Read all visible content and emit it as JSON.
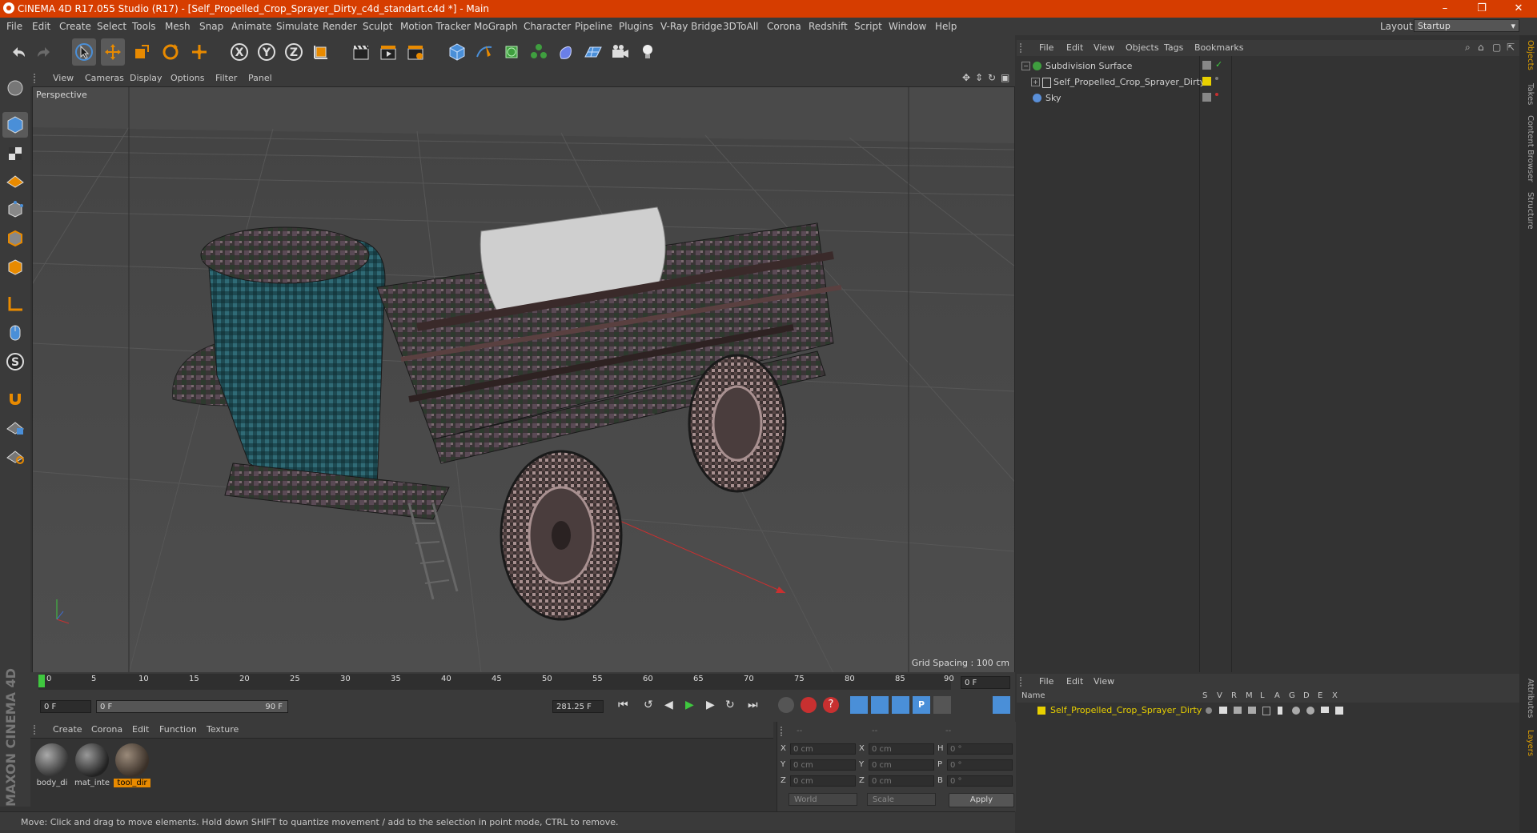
{
  "titlebar": {
    "title": "CINEMA 4D R17.055 Studio (R17) - [Self_Propelled_Crop_Sprayer_Dirty_c4d_standart.c4d *] - Main",
    "minimize": "–",
    "maximize": "❐",
    "close": "✕"
  },
  "menubar": {
    "items": [
      "File",
      "Edit",
      "Create",
      "Select",
      "Tools",
      "Mesh",
      "Snap",
      "Animate",
      "Simulate",
      "Render",
      "Sculpt",
      "Motion Tracker",
      "MoGraph",
      "Character",
      "Pipeline",
      "Plugins",
      "V-Ray Bridge",
      "3DToAll",
      "Corona",
      "Redshift",
      "Script",
      "Window",
      "Help"
    ],
    "layout_label": "Layout:",
    "layout_value": "Startup"
  },
  "viewport": {
    "menu": [
      "View",
      "Cameras",
      "Display",
      "Options",
      "Filter",
      "Panel"
    ],
    "label": "Perspective",
    "grid_spacing": "Grid Spacing : 100 cm"
  },
  "timeline": {
    "ticks": [
      "0",
      "5",
      "10",
      "15",
      "20",
      "25",
      "30",
      "35",
      "40",
      "45",
      "50",
      "55",
      "60",
      "65",
      "70",
      "75",
      "80",
      "85",
      "90"
    ],
    "end_field": "0 F"
  },
  "transport": {
    "current_frame": "0 F",
    "range_start": "0 F",
    "range_end": "90 F",
    "fps_field": "281.25 F"
  },
  "materials": {
    "menu": [
      "Create",
      "Corona",
      "Edit",
      "Function",
      "Texture"
    ],
    "items": [
      {
        "name": "body_di",
        "selected": false
      },
      {
        "name": "mat_inte",
        "selected": false
      },
      {
        "name": "tool_dir",
        "selected": true
      }
    ]
  },
  "coordinates": {
    "headers": [
      "--",
      "--",
      "--"
    ],
    "rows": [
      {
        "l1": "X",
        "v1": "0 cm",
        "l2": "X",
        "v2": "0 cm",
        "l3": "H",
        "v3": "0 °"
      },
      {
        "l1": "Y",
        "v1": "0 cm",
        "l2": "Y",
        "v2": "0 cm",
        "l3": "P",
        "v3": "0 °"
      },
      {
        "l1": "Z",
        "v1": "0 cm",
        "l2": "Z",
        "v2": "0 cm",
        "l3": "B",
        "v3": "0 °"
      }
    ],
    "mode_select": "World",
    "size_select": "Scale",
    "apply_label": "Apply"
  },
  "statusbar": {
    "text": "Move: Click and drag to move elements. Hold down SHIFT to quantize movement / add to the selection in point mode, CTRL to remove."
  },
  "objects_panel": {
    "menu": [
      "File",
      "Edit",
      "View",
      "Objects",
      "Tags",
      "Bookmarks"
    ],
    "items": [
      {
        "name": "Subdivision Surface",
        "color": "#3f9e3f"
      },
      {
        "name": "Self_Propelled_Crop_Sprayer_Dirty",
        "color": "#d8d8d8"
      },
      {
        "name": "Sky",
        "color": "#5a8fd8"
      }
    ]
  },
  "layers_panel": {
    "menu": [
      "File",
      "Edit",
      "View"
    ],
    "columns": [
      "Name",
      "S",
      "V",
      "R",
      "M",
      "L",
      "A",
      "G",
      "D",
      "E",
      "X"
    ],
    "items": [
      {
        "name": "Self_Propelled_Crop_Sprayer_Dirty",
        "color": "#e8d000"
      }
    ]
  },
  "side_tabs": [
    "Objects",
    "Takes",
    "Content Browser",
    "Structure",
    "Attributes",
    "Layers"
  ],
  "brand": "MAXON CINEMA 4D",
  "colors": {
    "title_bar": "#d63d00",
    "accent_blue": "#4a8fd8",
    "accent_orange": "#e88a00",
    "selection_yellow": "#e8d000"
  }
}
